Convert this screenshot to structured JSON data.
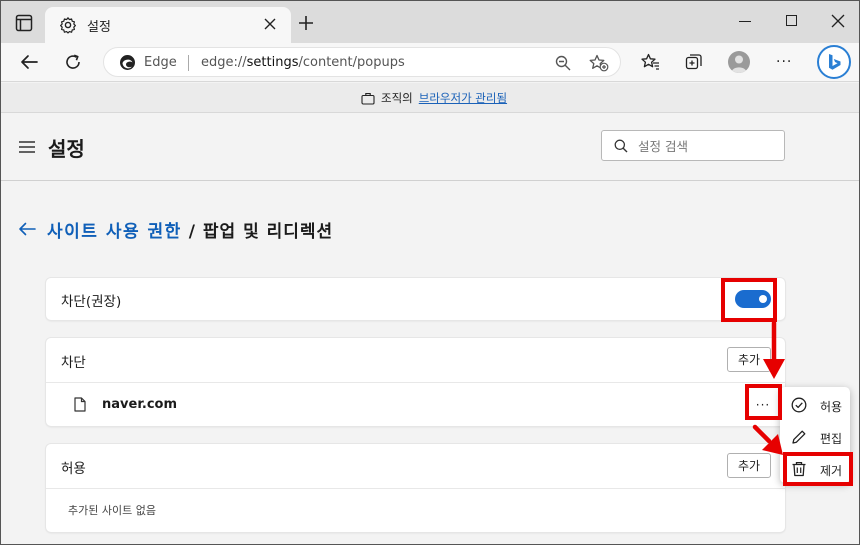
{
  "window": {
    "tab_title": "설정"
  },
  "address_bar": {
    "site_label": "Edge",
    "url_prefix": "edge://",
    "url_host": "settings",
    "url_path": "/content/popups"
  },
  "banner": {
    "prefix": "조직의",
    "link": "브라우저가 관리됨"
  },
  "header": {
    "title": "설정",
    "search_placeholder": "설정 검색"
  },
  "breadcrumb": {
    "parent": "사이트 사용 권한",
    "separator": " / ",
    "current": "팝업 및 리디렉션"
  },
  "block_setting": {
    "label": "차단(권장)",
    "enabled": true
  },
  "block_list": {
    "title": "차단",
    "add_label": "추가",
    "sites": [
      {
        "name": "naver.com",
        "more_label": "···"
      }
    ]
  },
  "allow_list": {
    "title": "허용",
    "add_label": "추가",
    "empty_text": "추가된 사이트 없음"
  },
  "context_menu": {
    "items": [
      {
        "label": "허용",
        "icon": "check-circle-icon"
      },
      {
        "label": "편집",
        "icon": "pencil-icon"
      },
      {
        "label": "제거",
        "icon": "trash-icon"
      }
    ]
  },
  "colors": {
    "accent": "#1a6ccf",
    "link": "#0f5fb8",
    "annotation": "#e60000"
  }
}
